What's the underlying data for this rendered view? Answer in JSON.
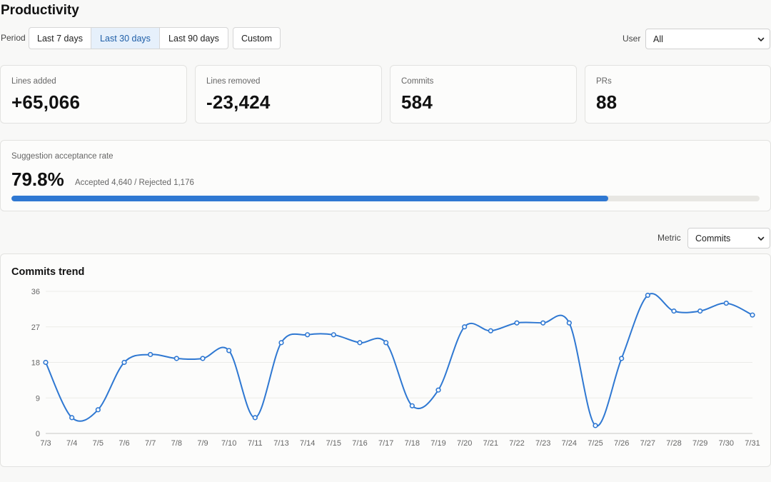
{
  "page": {
    "title": "Productivity"
  },
  "filters": {
    "period_label": "Period",
    "period_options": [
      {
        "label": "Last 7 days",
        "active": false
      },
      {
        "label": "Last 30 days",
        "active": true
      },
      {
        "label": "Last 90 days",
        "active": false
      }
    ],
    "custom_label": "Custom",
    "user_label": "User",
    "user_value": "All"
  },
  "stats": [
    {
      "label": "Lines added",
      "value": "+65,066"
    },
    {
      "label": "Lines removed",
      "value": "-23,424"
    },
    {
      "label": "Commits",
      "value": "584"
    },
    {
      "label": "PRs",
      "value": "88"
    }
  ],
  "acceptance": {
    "label": "Suggestion acceptance rate",
    "value": "79.8%",
    "detail": "Accepted 4,640 / Rejected 1,176",
    "fraction": 0.798
  },
  "metric": {
    "label": "Metric",
    "value": "Commits"
  },
  "colors": {
    "accent": "#2f78d2",
    "active_bg": "#e6f0fb",
    "active_text": "#1f5fa8",
    "track": "#e8e7e3"
  },
  "chart_data": {
    "type": "line",
    "title": "Commits trend",
    "xlabel": "",
    "ylabel": "",
    "ylim": [
      0,
      36
    ],
    "yticks": [
      0,
      9,
      18,
      27,
      36
    ],
    "grid": true,
    "legend": "none",
    "categories": [
      "7/3",
      "7/4",
      "7/5",
      "7/6",
      "7/7",
      "7/8",
      "7/9",
      "7/10",
      "7/11",
      "7/13",
      "7/14",
      "7/15",
      "7/16",
      "7/17",
      "7/18",
      "7/19",
      "7/20",
      "7/21",
      "7/22",
      "7/23",
      "7/24",
      "7/25",
      "7/26",
      "7/27",
      "7/28",
      "7/29",
      "7/30",
      "7/31"
    ],
    "series": [
      {
        "values": [
          18,
          4,
          6,
          18,
          20,
          19,
          19,
          21,
          4,
          23,
          25,
          25,
          23,
          23,
          7,
          11,
          27,
          26,
          28,
          28,
          28,
          2,
          19,
          35,
          31,
          31,
          33,
          30
        ],
        "color": "#2f78d2"
      }
    ]
  }
}
